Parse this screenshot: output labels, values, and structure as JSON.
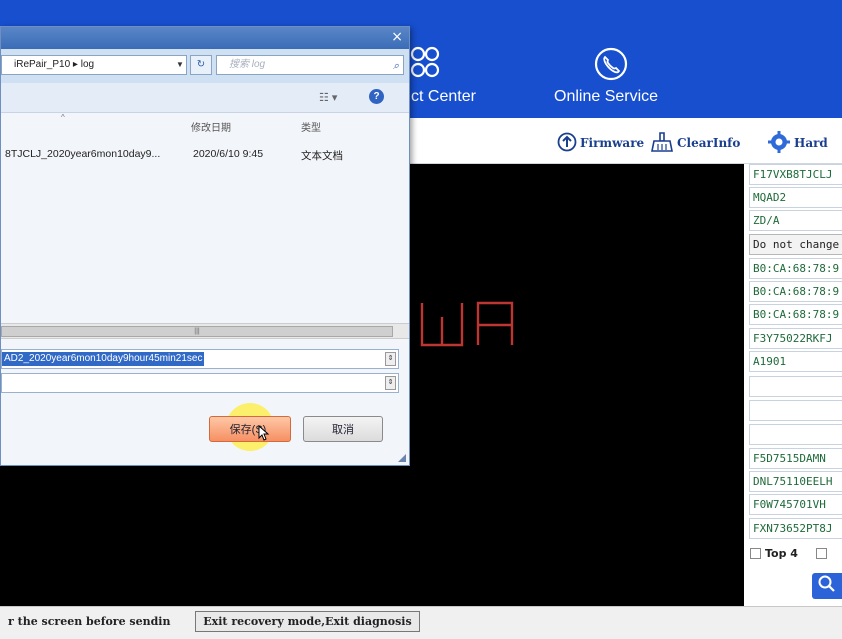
{
  "header": {
    "nav_product_label": "ct Center",
    "nav_online_label": "Online Service"
  },
  "toolbar": {
    "firmware_label": "Firmware",
    "clearinfo_label": "ClearInfo",
    "hard_label": "Hard"
  },
  "side": {
    "cells": [
      "F17VXB8TJCLJ",
      "MQAD2",
      "ZD/A",
      "Do not change",
      "B0:CA:68:78:9",
      "B0:CA:68:78:9",
      "B0:CA:68:78:9",
      "F3Y75022RKFJ",
      "A1901",
      "",
      "",
      "",
      "F5D7515DAMN",
      "DNL75110EELH",
      "F0W745701VH",
      "FXN73652PT8J"
    ],
    "top4_label": "Top 4"
  },
  "bottom": {
    "status_text": "r the screen before sendin",
    "exit_button": "Exit recovery mode,Exit diagnosis"
  },
  "watermark": {
    "brand": "REWA"
  },
  "dialog": {
    "address": "iRePair_P10 ▸ log",
    "search_placeholder": "搜索 log",
    "col_date": "修改日期",
    "col_type": "类型",
    "file_name": "8TJCLJ_2020year6mon10day9...",
    "file_date": "2020/6/10 9:45",
    "file_type": "文本文档",
    "filename_value": "AD2_2020year6mon10day9hour45min21sec",
    "save_label": "保存(S)",
    "cancel_label": "取消"
  },
  "colors": {
    "header_blue": "#174fcf",
    "console_black": "#000000",
    "side_text_green": "#1f6a3a",
    "watermark_red": "#e0403a"
  }
}
